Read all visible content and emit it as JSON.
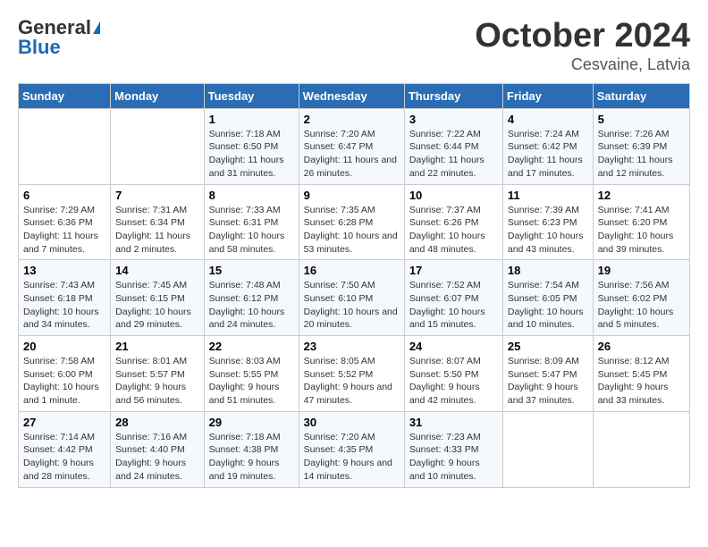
{
  "logo": {
    "general": "General",
    "blue": "Blue"
  },
  "title": "October 2024",
  "location": "Cesvaine, Latvia",
  "days_of_week": [
    "Sunday",
    "Monday",
    "Tuesday",
    "Wednesday",
    "Thursday",
    "Friday",
    "Saturday"
  ],
  "weeks": [
    [
      {
        "day": "",
        "info": ""
      },
      {
        "day": "",
        "info": ""
      },
      {
        "day": "1",
        "info": "Sunrise: 7:18 AM\nSunset: 6:50 PM\nDaylight: 11 hours and 31 minutes."
      },
      {
        "day": "2",
        "info": "Sunrise: 7:20 AM\nSunset: 6:47 PM\nDaylight: 11 hours and 26 minutes."
      },
      {
        "day": "3",
        "info": "Sunrise: 7:22 AM\nSunset: 6:44 PM\nDaylight: 11 hours and 22 minutes."
      },
      {
        "day": "4",
        "info": "Sunrise: 7:24 AM\nSunset: 6:42 PM\nDaylight: 11 hours and 17 minutes."
      },
      {
        "day": "5",
        "info": "Sunrise: 7:26 AM\nSunset: 6:39 PM\nDaylight: 11 hours and 12 minutes."
      }
    ],
    [
      {
        "day": "6",
        "info": "Sunrise: 7:29 AM\nSunset: 6:36 PM\nDaylight: 11 hours and 7 minutes."
      },
      {
        "day": "7",
        "info": "Sunrise: 7:31 AM\nSunset: 6:34 PM\nDaylight: 11 hours and 2 minutes."
      },
      {
        "day": "8",
        "info": "Sunrise: 7:33 AM\nSunset: 6:31 PM\nDaylight: 10 hours and 58 minutes."
      },
      {
        "day": "9",
        "info": "Sunrise: 7:35 AM\nSunset: 6:28 PM\nDaylight: 10 hours and 53 minutes."
      },
      {
        "day": "10",
        "info": "Sunrise: 7:37 AM\nSunset: 6:26 PM\nDaylight: 10 hours and 48 minutes."
      },
      {
        "day": "11",
        "info": "Sunrise: 7:39 AM\nSunset: 6:23 PM\nDaylight: 10 hours and 43 minutes."
      },
      {
        "day": "12",
        "info": "Sunrise: 7:41 AM\nSunset: 6:20 PM\nDaylight: 10 hours and 39 minutes."
      }
    ],
    [
      {
        "day": "13",
        "info": "Sunrise: 7:43 AM\nSunset: 6:18 PM\nDaylight: 10 hours and 34 minutes."
      },
      {
        "day": "14",
        "info": "Sunrise: 7:45 AM\nSunset: 6:15 PM\nDaylight: 10 hours and 29 minutes."
      },
      {
        "day": "15",
        "info": "Sunrise: 7:48 AM\nSunset: 6:12 PM\nDaylight: 10 hours and 24 minutes."
      },
      {
        "day": "16",
        "info": "Sunrise: 7:50 AM\nSunset: 6:10 PM\nDaylight: 10 hours and 20 minutes."
      },
      {
        "day": "17",
        "info": "Sunrise: 7:52 AM\nSunset: 6:07 PM\nDaylight: 10 hours and 15 minutes."
      },
      {
        "day": "18",
        "info": "Sunrise: 7:54 AM\nSunset: 6:05 PM\nDaylight: 10 hours and 10 minutes."
      },
      {
        "day": "19",
        "info": "Sunrise: 7:56 AM\nSunset: 6:02 PM\nDaylight: 10 hours and 5 minutes."
      }
    ],
    [
      {
        "day": "20",
        "info": "Sunrise: 7:58 AM\nSunset: 6:00 PM\nDaylight: 10 hours and 1 minute."
      },
      {
        "day": "21",
        "info": "Sunrise: 8:01 AM\nSunset: 5:57 PM\nDaylight: 9 hours and 56 minutes."
      },
      {
        "day": "22",
        "info": "Sunrise: 8:03 AM\nSunset: 5:55 PM\nDaylight: 9 hours and 51 minutes."
      },
      {
        "day": "23",
        "info": "Sunrise: 8:05 AM\nSunset: 5:52 PM\nDaylight: 9 hours and 47 minutes."
      },
      {
        "day": "24",
        "info": "Sunrise: 8:07 AM\nSunset: 5:50 PM\nDaylight: 9 hours and 42 minutes."
      },
      {
        "day": "25",
        "info": "Sunrise: 8:09 AM\nSunset: 5:47 PM\nDaylight: 9 hours and 37 minutes."
      },
      {
        "day": "26",
        "info": "Sunrise: 8:12 AM\nSunset: 5:45 PM\nDaylight: 9 hours and 33 minutes."
      }
    ],
    [
      {
        "day": "27",
        "info": "Sunrise: 7:14 AM\nSunset: 4:42 PM\nDaylight: 9 hours and 28 minutes."
      },
      {
        "day": "28",
        "info": "Sunrise: 7:16 AM\nSunset: 4:40 PM\nDaylight: 9 hours and 24 minutes."
      },
      {
        "day": "29",
        "info": "Sunrise: 7:18 AM\nSunset: 4:38 PM\nDaylight: 9 hours and 19 minutes."
      },
      {
        "day": "30",
        "info": "Sunrise: 7:20 AM\nSunset: 4:35 PM\nDaylight: 9 hours and 14 minutes."
      },
      {
        "day": "31",
        "info": "Sunrise: 7:23 AM\nSunset: 4:33 PM\nDaylight: 9 hours and 10 minutes."
      },
      {
        "day": "",
        "info": ""
      },
      {
        "day": "",
        "info": ""
      }
    ]
  ]
}
